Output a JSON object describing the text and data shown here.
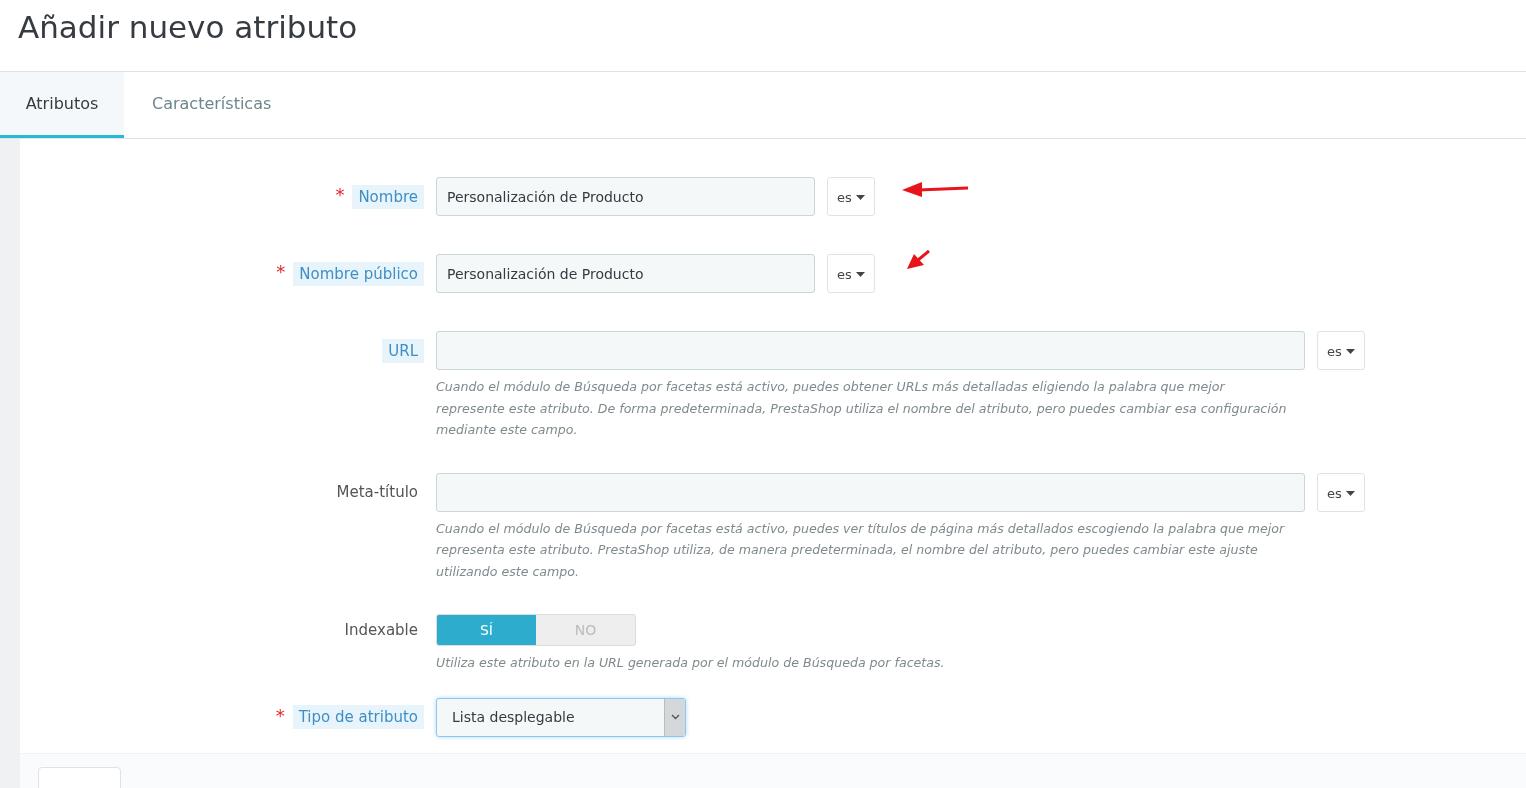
{
  "page_title": "Añadir nuevo atributo",
  "tabs": [
    {
      "label": "Atributos",
      "selected": true
    },
    {
      "label": "Características",
      "selected": false
    }
  ],
  "fields": [
    {
      "kind": "short",
      "label": "Nombre",
      "required_mark": "*",
      "tooltip": true,
      "value": "Personalización de Producto",
      "lang": "es"
    },
    {
      "kind": "short",
      "label": "Nombre público",
      "required_mark": "*",
      "tooltip": true,
      "value": "Personalización de Producto",
      "lang": "es"
    },
    {
      "kind": "long",
      "label": "URL",
      "tooltip": true,
      "lang": "es",
      "help": "Cuando el módulo de Búsqueda por facetas está activo, puedes obtener URLs más detalladas eligiendo la palabra que mejor represente este atributo. De forma predeterminada, PrestaShop utiliza el nombre del atributo, pero puedes cambiar esa configuración mediante este campo."
    },
    {
      "kind": "long",
      "label": "Meta-título",
      "tooltip": false,
      "lang": "es",
      "help": "Cuando el módulo de Búsqueda por facetas está activo, puedes ver títulos de página más detallados escogiendo la palabra que mejor representa este atributo. PrestaShop utiliza, de manera predeterminada, el nombre del atributo, pero puedes cambiar este ajuste utilizando este campo."
    },
    {
      "kind": "toggle",
      "label": "Indexable",
      "tooltip": false,
      "options": [
        {
          "label": "SÍ",
          "selected": true
        },
        {
          "label": "NO",
          "selected": false
        }
      ],
      "help": "Utiliza este atributo en la URL generada por el módulo de Búsqueda por facetas."
    },
    {
      "kind": "select",
      "label": "Tipo de atributo",
      "required_mark": "*",
      "tooltip": true,
      "value": "Lista desplegable"
    }
  ]
}
